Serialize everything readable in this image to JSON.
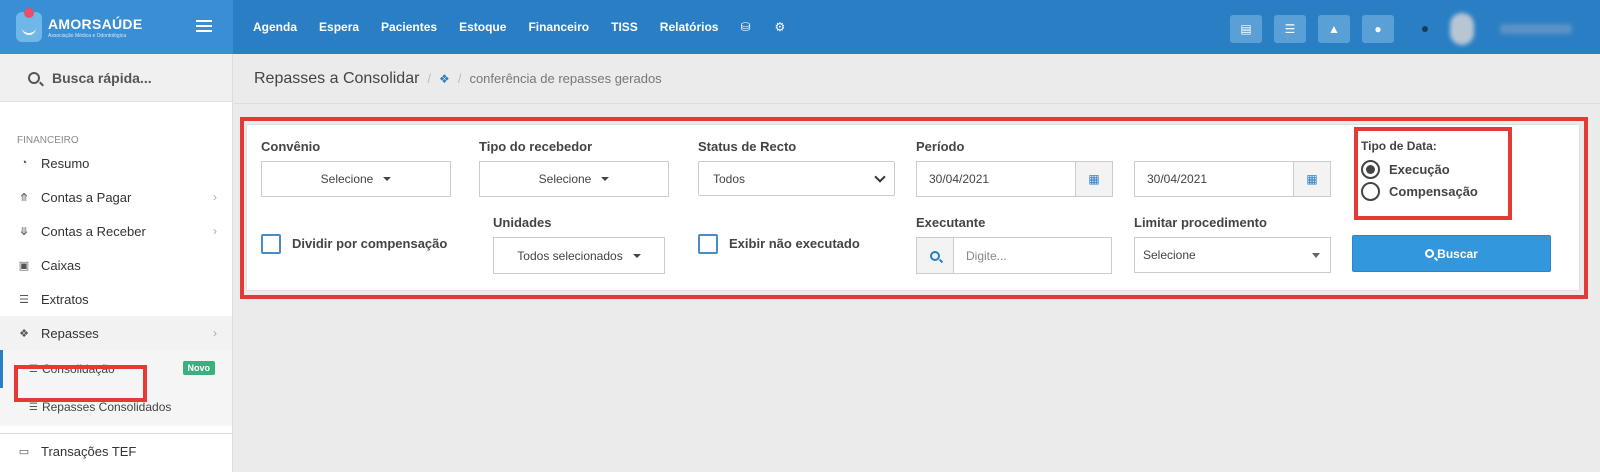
{
  "brand": {
    "name": "AMORSAÚDE",
    "tagline": "Associação Médica e Odontológica"
  },
  "topnav": {
    "items": [
      "Agenda",
      "Espera",
      "Pacientes",
      "Estoque",
      "Financeiro",
      "TISS",
      "Relatórios"
    ],
    "icons": [
      "database-icon",
      "gear-icon"
    ],
    "right_icons": [
      "inbox-icon",
      "card-icon",
      "bell-icon",
      "chat-icon"
    ]
  },
  "sidebar": {
    "quick_search": "Busca rápida...",
    "section": "FINANCEIRO",
    "items": [
      {
        "label": "Resumo",
        "icon": "pie-chart-icon",
        "has_children": false
      },
      {
        "label": "Contas a Pagar",
        "icon": "arrow-up-circle-icon",
        "has_children": true
      },
      {
        "label": "Contas a Receber",
        "icon": "arrow-down-circle-icon",
        "has_children": true
      },
      {
        "label": "Caixas",
        "icon": "inbox-icon",
        "has_children": false
      },
      {
        "label": "Extratos",
        "icon": "list-icon",
        "has_children": false
      },
      {
        "label": "Repasses",
        "icon": "puzzle-icon",
        "has_children": true
      }
    ],
    "subitems": [
      {
        "label": "Consolidação",
        "badge": "Novo"
      },
      {
        "label": "Repasses Consolidados"
      }
    ],
    "after_items": [
      {
        "label": "Transações TEF",
        "icon": "credit-card-icon"
      }
    ]
  },
  "breadcrumb": {
    "title": "Repasses a Consolidar",
    "separator": "/",
    "current": "conferência de repasses gerados"
  },
  "form": {
    "convenio": {
      "label": "Convênio",
      "value": "Selecione"
    },
    "tipo_recebedor": {
      "label": "Tipo do recebedor",
      "value": "Selecione"
    },
    "status_recto": {
      "label": "Status de Recto",
      "value": "Todos"
    },
    "periodo": {
      "label": "Período",
      "start": "30/04/2021",
      "end": "30/04/2021"
    },
    "tipo_data": {
      "label": "Tipo de Data:",
      "options": [
        "Execução",
        "Compensação"
      ],
      "selected": "Execução"
    },
    "dividir": {
      "label": "Dividir por compensação",
      "checked": false
    },
    "unidades": {
      "label": "Unidades",
      "value": "Todos selecionados"
    },
    "exibir": {
      "label": "Exibir não executado",
      "checked": false
    },
    "executante": {
      "label": "Executante",
      "placeholder": "Digite..."
    },
    "limitar": {
      "label": "Limitar procedimento",
      "value": "Selecione"
    },
    "buscar_label": "Buscar"
  },
  "colors": {
    "topbar": "#2a7fc4",
    "accent": "#3297dc",
    "highlight": "#e53935",
    "badge": "#3bb07f"
  }
}
